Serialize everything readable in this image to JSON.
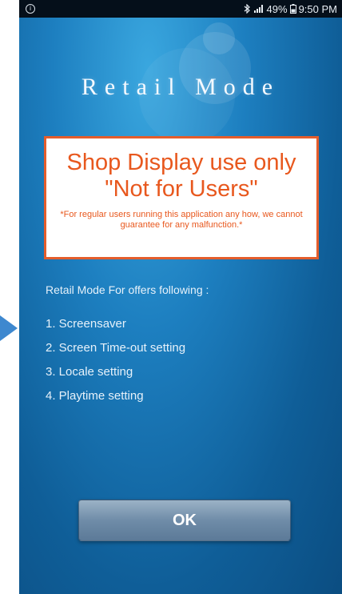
{
  "status_bar": {
    "battery_percent": "49%",
    "time": "9:50 PM",
    "icons": [
      "info-icon",
      "bluetooth-icon",
      "signal-icon",
      "battery-icon"
    ]
  },
  "app": {
    "title": "Retail Mode"
  },
  "warning": {
    "line1": "Shop Display use only",
    "line2": "\"Not for Users\"",
    "note": "*For regular users running this application any how, we cannot guarantee for any malfunction.*"
  },
  "features": {
    "heading": "Retail Mode For offers following :",
    "items": [
      "1. Screensaver",
      "2. Screen Time-out setting",
      "3. Locale setting",
      "4. Playtime setting"
    ]
  },
  "buttons": {
    "ok_label": "OK"
  },
  "colors": {
    "accent_orange": "#e45d2c",
    "background_blue": "#1d7fc0",
    "arrow_blue": "#3e88cf"
  }
}
